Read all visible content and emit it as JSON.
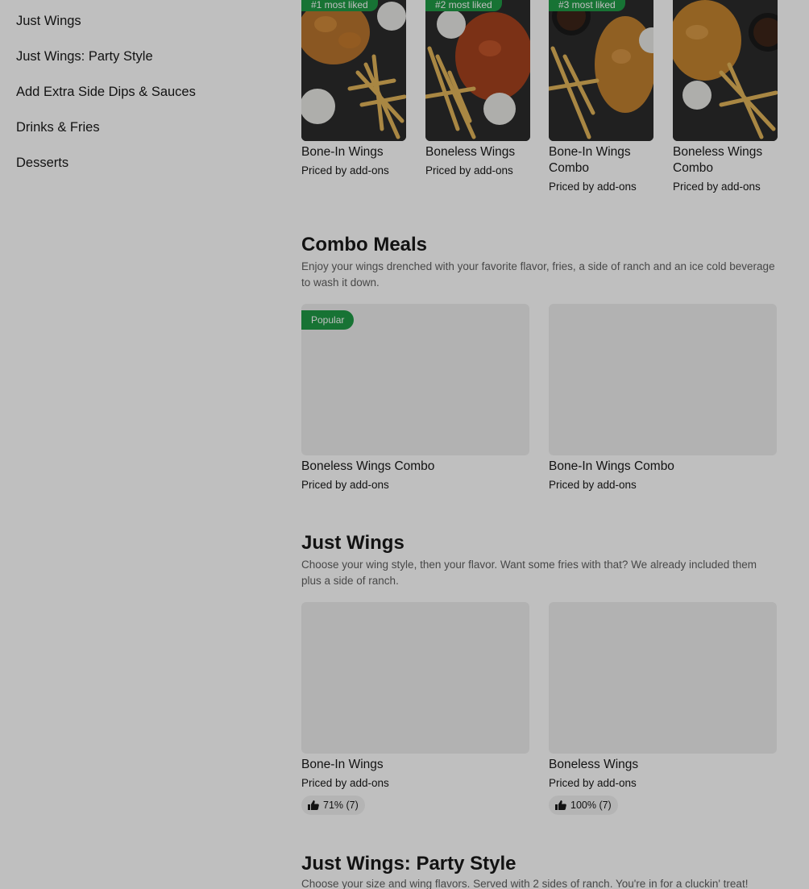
{
  "sidebar": {
    "items": [
      {
        "label": "Just Wings"
      },
      {
        "label": "Just Wings: Party Style"
      },
      {
        "label": "Add Extra Side Dips & Sauces"
      },
      {
        "label": "Drinks & Fries"
      },
      {
        "label": "Desserts"
      }
    ]
  },
  "most_liked": [
    {
      "badge": "#1 most liked",
      "title": "Bone-In Wings",
      "price": "Priced by add-ons"
    },
    {
      "badge": "#2 most liked",
      "title": "Boneless Wings",
      "price": "Priced by add-ons"
    },
    {
      "badge": "#3 most liked",
      "title": "Bone-In Wings Combo",
      "price": "Priced by add-ons"
    },
    {
      "badge": "",
      "title": "Boneless Wings Combo",
      "price": "Priced by add-ons"
    }
  ],
  "combo": {
    "title": "Combo Meals",
    "desc": "Enjoy your wings drenched with your favorite flavor, fries, a side of ranch and an ice cold beverage to wash it down.",
    "items": [
      {
        "badge": "Popular",
        "title": "Boneless Wings Combo",
        "price": "Priced by add-ons"
      },
      {
        "title": "Bone-In Wings Combo",
        "price": "Priced by add-ons"
      }
    ]
  },
  "just_wings": {
    "title": "Just Wings",
    "desc": "Choose your wing style, then your flavor. Want some fries with that? We already included them plus a side of ranch.",
    "items": [
      {
        "title": "Bone-In Wings",
        "price": "Priced by add-ons",
        "rating": "71% (7)"
      },
      {
        "title": "Boneless Wings",
        "price": "Priced by add-ons",
        "rating": "100% (7)"
      }
    ]
  },
  "party": {
    "title": "Just Wings: Party Style",
    "desc": "Choose your size and wing flavors. Served with 2 sides of ranch. You're in for a cluckin' treat!"
  },
  "colors": {
    "accent": "#1f9a46",
    "overlay": "rgba(0,0,0,0.25)"
  }
}
